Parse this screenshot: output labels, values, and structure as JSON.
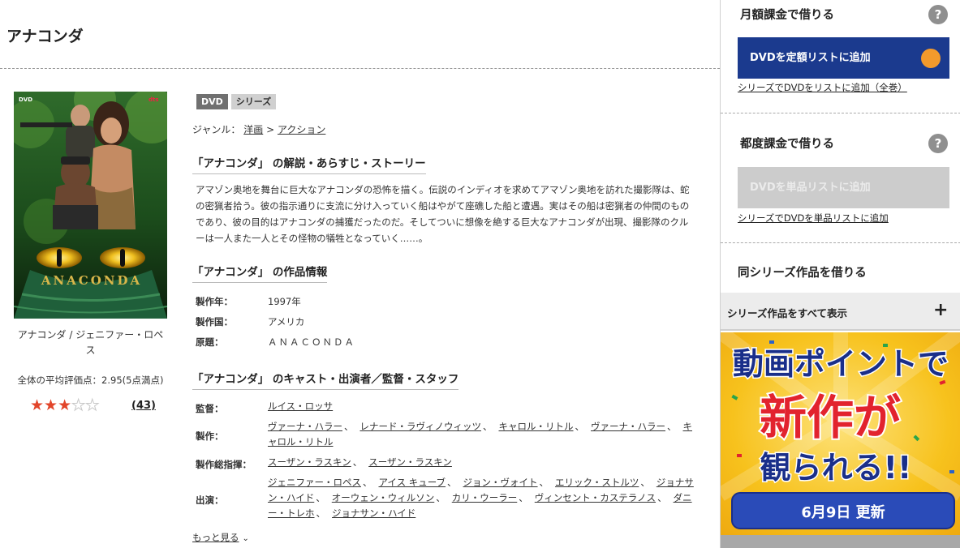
{
  "page": {
    "title": "アナコンダ"
  },
  "cover": {
    "caption": "アナコンダ / ジェニファー・ロペス",
    "logo_text": "ANACONDA",
    "badge_left": "DVD",
    "badge_right": "dts"
  },
  "rating": {
    "average_text": "全体の平均評価点：2.95(5点満点)",
    "stars_filled": 3,
    "stars_total": 5,
    "review_count": "(43)"
  },
  "tags": [
    "DVD",
    "シリーズ"
  ],
  "genre": {
    "label": "ジャンル：",
    "parent": "洋画",
    "separator": ">",
    "child": "アクション"
  },
  "sections": {
    "synopsis_title": "「アナコンダ」 の解説・あらすじ・ストーリー",
    "synopsis_text": "アマゾン奥地を舞台に巨大なアナコンダの恐怖を描く。伝説のインディオを求めてアマゾン奥地を訪れた撮影隊は、蛇の密猟者拾う。彼の指示通りに支流に分け入っていく船はやがて座礁した船と遭遇。実はその船は密猟者の仲間のものであり、彼の目的はアナコンダの捕獲だったのだ。そしてついに想像を絶する巨大なアナコンダが出現、撮影隊のクルーは一人また一人とその怪物の犠牲となっていく……。",
    "info_title": "「アナコンダ」 の作品情報",
    "cast_title": "「アナコンダ」 のキャスト・出演者／監督・スタッフ"
  },
  "info": [
    {
      "label": "製作年：",
      "value": "1997年"
    },
    {
      "label": "製作国：",
      "value": "アメリカ"
    },
    {
      "label": "原題：",
      "value": "ＡＮＡＣＯＮＤＡ"
    }
  ],
  "staff": [
    {
      "label": "監督：",
      "names": [
        "ルイス・ロッサ"
      ]
    },
    {
      "label": "製作：",
      "names": [
        "ヴァーナ・ハラー",
        "レナード・ラヴィノウィッツ",
        "キャロル・リトル",
        "ヴァーナ・ハラー",
        "キャロル・リトル"
      ]
    },
    {
      "label": "製作総指揮：",
      "names": [
        "スーザン・ラスキン",
        "スーザン・ラスキン"
      ]
    },
    {
      "label": "出演：",
      "names": [
        "ジェニファー・ロペス",
        "アイス キューブ",
        "ジョン・ヴォイト",
        "エリック・ストルツ",
        "ジョナサン・ハイド",
        "オーウェン・ウィルソン",
        "カリ・ウーラー",
        "ヴィンセント・カステラノス",
        "ダニー・トレホ",
        "ジョナサン・ハイド"
      ]
    }
  ],
  "more_link": "もっと見る",
  "sidebar": {
    "monthly_title": "月額課金で借りる",
    "monthly_button": "DVDを定額リストに追加",
    "monthly_link": "シリーズでDVDをリストに追加（全巻）",
    "perrental_title": "都度課金で借りる",
    "perrental_button": "DVDを単品リストに追加",
    "perrental_link": "シリーズでDVDを単品リストに追加",
    "series_title": "同シリーズ作品を借りる",
    "series_show_all": "シリーズ作品をすべて表示",
    "help_glyph": "?",
    "plus_glyph": "+"
  },
  "banner": {
    "line1": "動画ポイントで",
    "line2": "新作が",
    "line3": "観られる!!",
    "date": "6月9日 更新"
  },
  "colors": {
    "primary_button": "#1b3a8e",
    "button_dot": "#f39a2c",
    "star_on": "#e2452a",
    "banner_bg": "#f7c21d",
    "banner_accent": "#e2232e",
    "banner_text": "#1a2f8a"
  },
  "icons": [
    "help-icon",
    "plus-icon",
    "chevron-down-icon",
    "star-icon"
  ]
}
